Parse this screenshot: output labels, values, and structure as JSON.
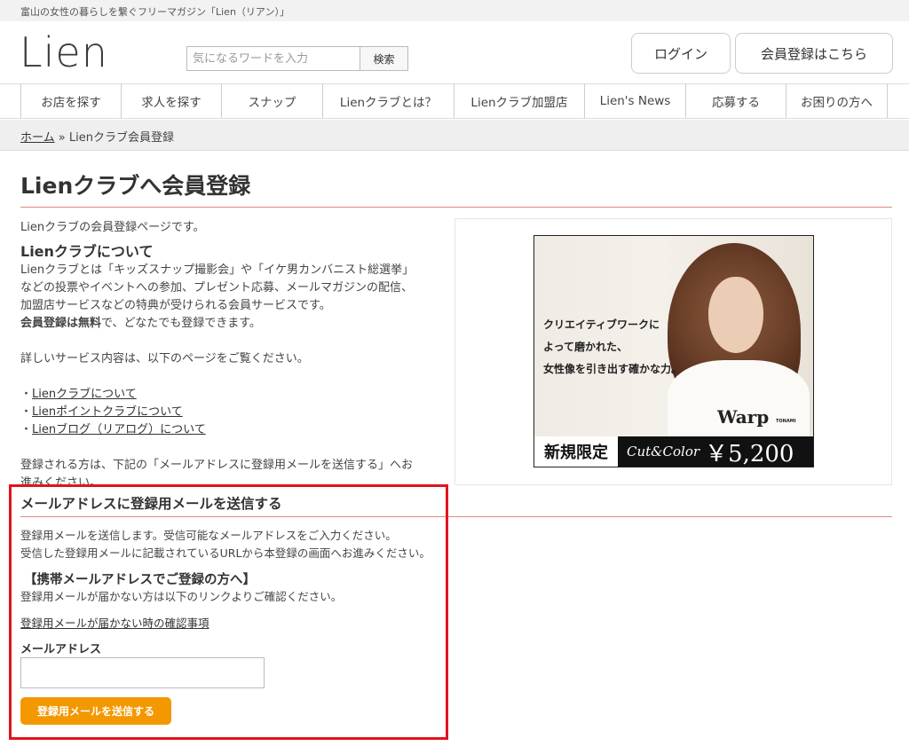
{
  "topbar": {
    "tagline": "富山の女性の暮らしを繋ぐフリーマガジン「Lien（リアン）」"
  },
  "header": {
    "logo": "Lien",
    "search_placeholder": "気になるワードを入力",
    "search_button": "検索",
    "login_button": "ログイン",
    "register_button": "会員登録はこちら"
  },
  "nav": {
    "items": [
      {
        "label": "お店を探す"
      },
      {
        "label": "求人を探す"
      },
      {
        "label": "スナップ"
      },
      {
        "label": "Lienクラブとは？"
      },
      {
        "label": "Lienクラブ加盟店"
      },
      {
        "label": "Lien's News"
      },
      {
        "label": "応募する"
      },
      {
        "label": "お困りの方へ"
      }
    ]
  },
  "breadcrumb": {
    "home": "ホーム",
    "separator": "»",
    "current": "Lienクラブ会員登録"
  },
  "page": {
    "title": "Lienクラブへ会員登録",
    "intro": "Lienクラブの会員登録ページです。",
    "about_heading": "Lienクラブについて",
    "about_text": "Lienクラブとは「キッズスナップ撮影会」や「イケ男カンバニスト総選挙」などの投票やイベントへの参加、プレゼント応募、メールマガジンの配信、加盟店サービスなどの特典が受けられる会員サービスです。",
    "free_bold": "会員登録は無料",
    "free_rest": "で、どなたでも登録できます。",
    "details_text": "詳しいサービス内容は、以下のページをご覧ください。",
    "links": [
      {
        "label": "Lienクラブについて"
      },
      {
        "label": "Lienポイントクラブについて"
      },
      {
        "label": "Lienブログ（リアログ）について"
      }
    ],
    "bullet": "・",
    "proceed_text": "登録される方は、下記の「メールアドレスに登録用メールを送信する」へお進みください。"
  },
  "ad": {
    "copy_line1": "クリエイティブワークに",
    "copy_line2": "よって磨かれた、",
    "copy_line3": "女性像を引き出す確かな力。",
    "brand": "Warp",
    "brand_sub": "TONAMI",
    "limited": "新規限定",
    "service": "Cut&Color",
    "price": "￥5,200"
  },
  "form": {
    "section_title": "メールアドレスに登録用メールを送信する",
    "desc_line1": "登録用メールを送信します。受信可能なメールアドレスをご入力ください。",
    "desc_line2": "受信した登録用メールに記載されているURLから本登録の画面へお進みください。",
    "mobile_heading": "【携帯メールアドレスでご登録の方へ】",
    "mobile_text": "登録用メールが届かない方は以下のリンクよりご確認ください。",
    "check_link": "登録用メールが届かない時の確認事項",
    "email_label": "メールアドレス",
    "email_value": "",
    "submit_button": "登録用メールを送信する"
  },
  "colors": {
    "accent_rule": "#e08a80",
    "highlight_border": "#e0141e",
    "submit_button": "#f39800"
  }
}
